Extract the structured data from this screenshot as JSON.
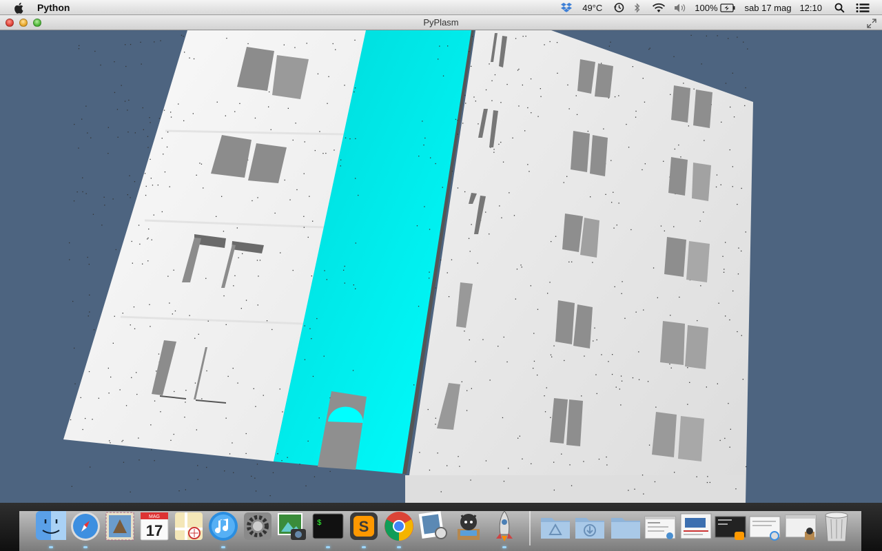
{
  "menubar": {
    "app_name": "Python",
    "status": {
      "temperature": "49°C",
      "battery": "100%",
      "date": "sab 17 mag",
      "time": "12:10"
    }
  },
  "window": {
    "title": "PyPlasm"
  },
  "scene": {
    "background_color": "#4d6480",
    "wall_color": "#ececec",
    "stairwell_color": "#00ffff",
    "window_color": "#8c8c8c"
  },
  "dock": {
    "calendar_month": "MAG",
    "calendar_day": "17",
    "terminal_prompt": "$",
    "sublime_letter": "S",
    "items": [
      "finder-icon",
      "safari-icon",
      "mail-icon",
      "calendar-icon",
      "maps-icon",
      "itunes-icon",
      "system-preferences-icon",
      "image-capture-icon",
      "terminal-icon",
      "sublime-text-icon",
      "chrome-icon",
      "preview-icon",
      "github-icon",
      "python-launcher-icon",
      "applications-folder-icon",
      "downloads-folder-icon",
      "documents-folder-icon",
      "window-thumbnail-icon",
      "window-thumbnail-icon",
      "window-thumbnail-icon",
      "window-thumbnail-icon",
      "window-thumbnail-icon",
      "trash-icon"
    ]
  }
}
